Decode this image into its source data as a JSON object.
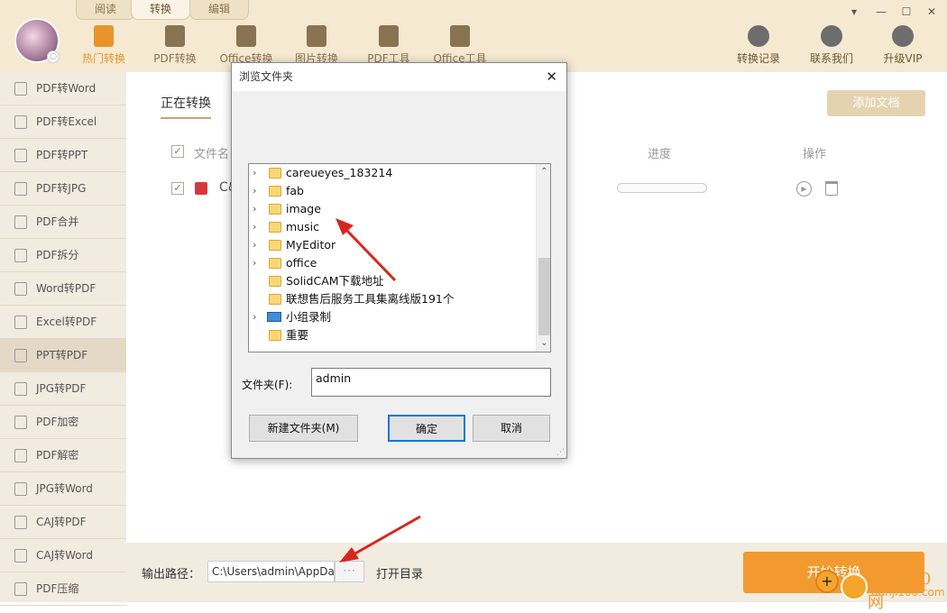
{
  "app": {
    "mode_tabs": [
      "阅读",
      "转换",
      "编辑"
    ],
    "nav": [
      "热门转换",
      "PDF转换",
      "Office转换",
      "图片转换",
      "PDF工具",
      "Office工具"
    ],
    "right_nav": [
      "转换记录",
      "联系我们",
      "升级VIP"
    ],
    "window_controls": [
      "▾",
      "—",
      "☐",
      "✕"
    ]
  },
  "sidebar": {
    "items": [
      "PDF转Word",
      "PDF转Excel",
      "PDF转PPT",
      "PDF转JPG",
      "PDF合并",
      "PDF拆分",
      "Word转PDF",
      "Excel转PDF",
      "PPT转PDF",
      "JPG转PDF",
      "PDF加密",
      "PDF解密",
      "JPG转Word",
      "CAJ转PDF",
      "CAJ转Word",
      "PDF压缩"
    ],
    "active": "PPT转PDF"
  },
  "main": {
    "tab": "正在转换",
    "add_button": "添加文档",
    "columns": {
      "name": "文件名",
      "progress": "进度",
      "action": "操作"
    },
    "row_name": "C&"
  },
  "dialog": {
    "title": "浏览文件夹",
    "tree": [
      {
        "label": "careueyes_183214",
        "expandable": true,
        "icon": "folder"
      },
      {
        "label": "fab",
        "expandable": true,
        "icon": "folder"
      },
      {
        "label": "image",
        "expandable": true,
        "icon": "folder"
      },
      {
        "label": "music",
        "expandable": true,
        "icon": "folder"
      },
      {
        "label": "MyEditor",
        "expandable": true,
        "icon": "folder"
      },
      {
        "label": "office",
        "expandable": true,
        "icon": "folder"
      },
      {
        "label": "SolidCAM下载地址",
        "expandable": false,
        "icon": "folder"
      },
      {
        "label": "联想售后服务工具集离线版191个",
        "expandable": false,
        "icon": "folder"
      },
      {
        "label": "小组录制",
        "expandable": true,
        "icon": "computer"
      },
      {
        "label": "重要",
        "expandable": false,
        "icon": "folder"
      }
    ],
    "folder_label": "文件夹(F):",
    "folder_value": "admin",
    "new_folder": "新建文件夹(M)",
    "ok": "确定",
    "cancel": "取消"
  },
  "bottom": {
    "output_label": "输出路径：",
    "output_path": "C:\\Users\\admin\\AppDa",
    "browse": "···",
    "open_dir": "打开目录",
    "start": "开始转换"
  },
  "watermark": {
    "text1": "单机100网",
    "text2": "danji100.com"
  },
  "colors": {
    "accent": "#f29a2e",
    "topbar": "#f5e9d2",
    "sidebar": "#f2ebe0",
    "annotation": "#d9261c"
  }
}
